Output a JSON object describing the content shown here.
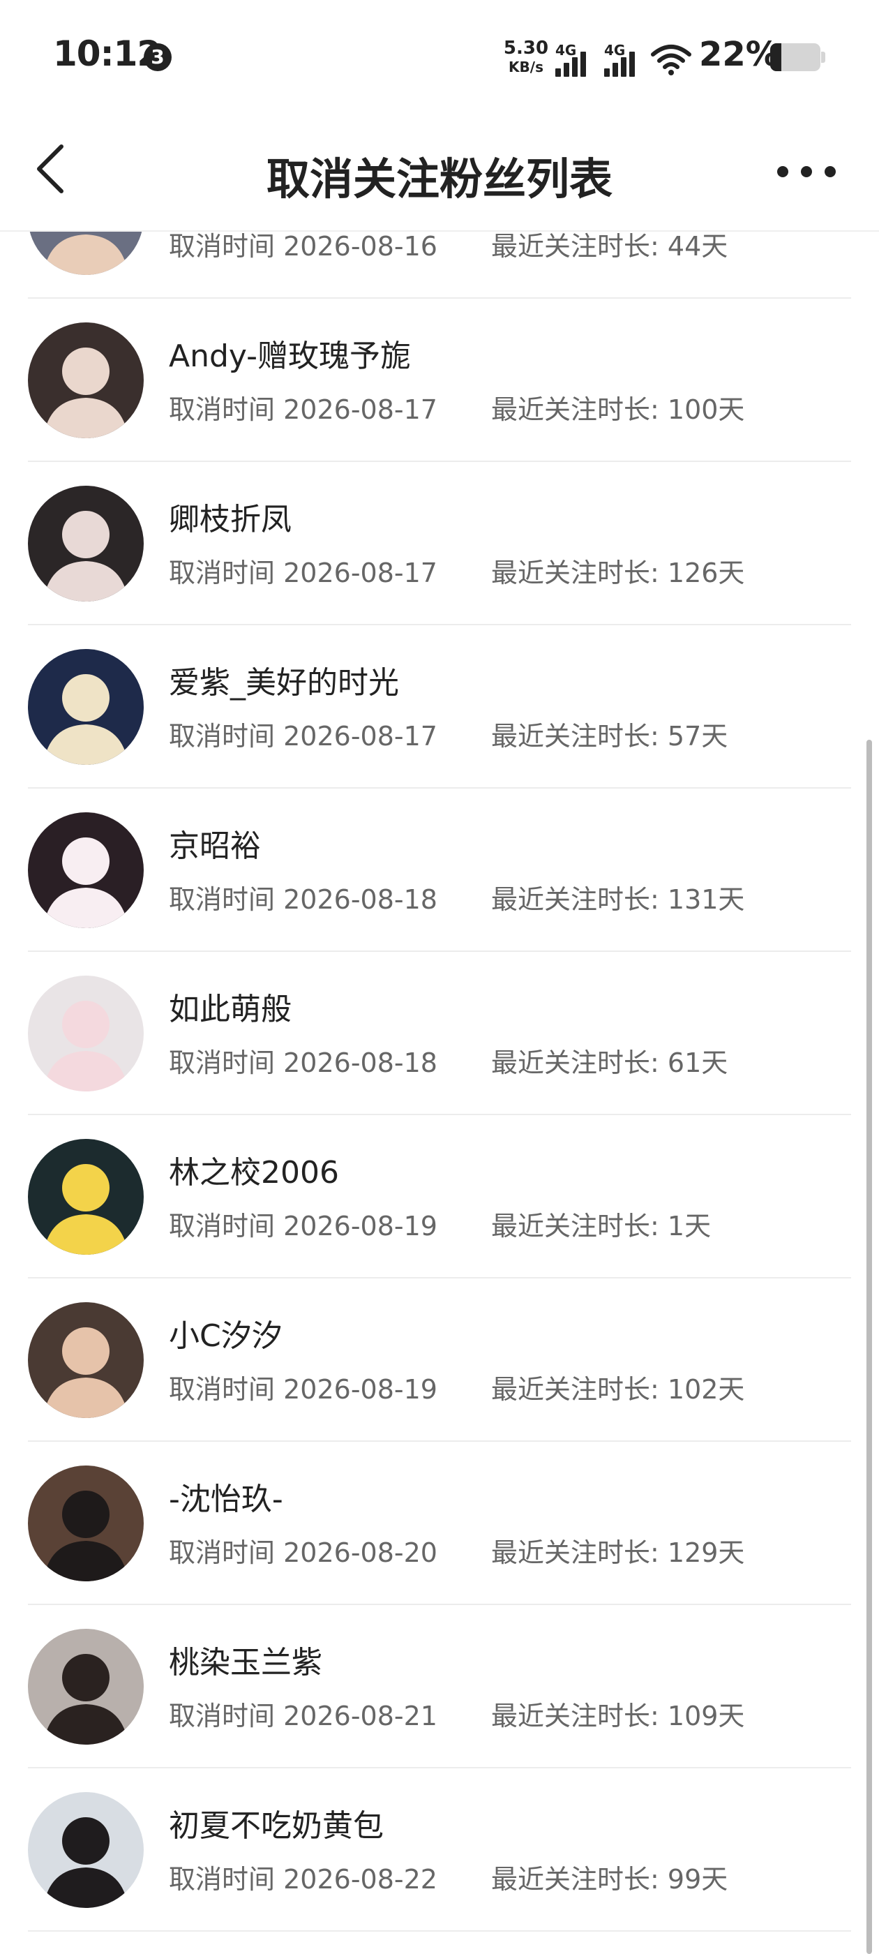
{
  "status_bar": {
    "time": "10:12",
    "notification_count": "3",
    "net_speed_value": "5.30",
    "net_speed_unit": "KB/s",
    "signal1_label": "4G",
    "signal2_label": "4G",
    "battery_percent": "22%",
    "battery_level": 0.22
  },
  "nav": {
    "title": "取消关注粉丝列表",
    "back_icon": "chevron-left-icon",
    "more_icon": "more-horizontal-icon"
  },
  "list": {
    "time_prefix": "取消时间",
    "duration_prefix": "最近关注时长:",
    "items": [
      {
        "name": "",
        "date": "2026-08-16",
        "duration": "44天",
        "avatar_bg": "#6a6f82",
        "avatar_fg": "#e9cdb8"
      },
      {
        "name": "Andy-赠玫瑰予旎",
        "date": "2026-08-17",
        "duration": "100天",
        "avatar_bg": "#3a2f2d",
        "avatar_fg": "#ead7cd"
      },
      {
        "name": "卿枝折凤",
        "date": "2026-08-17",
        "duration": "126天",
        "avatar_bg": "#2b2627",
        "avatar_fg": "#e8d9d6"
      },
      {
        "name": "爱紫_美好的时光",
        "date": "2026-08-17",
        "duration": "57天",
        "avatar_bg": "#1e2a4a",
        "avatar_fg": "#efe3c6"
      },
      {
        "name": "京昭裕",
        "date": "2026-08-18",
        "duration": "131天",
        "avatar_bg": "#2a1f25",
        "avatar_fg": "#f8eef2"
      },
      {
        "name": "如此萌般",
        "date": "2026-08-18",
        "duration": "61天",
        "avatar_bg": "#e9e4e6",
        "avatar_fg": "#f4d9de"
      },
      {
        "name": "林之校2006",
        "date": "2026-08-19",
        "duration": "1天",
        "avatar_bg": "#1c2b2e",
        "avatar_fg": "#f3d34a"
      },
      {
        "name": "小C汐汐",
        "date": "2026-08-19",
        "duration": "102天",
        "avatar_bg": "#4a3a33",
        "avatar_fg": "#e6c3aa"
      },
      {
        "name": "-沈怡玖-",
        "date": "2026-08-20",
        "duration": "129天",
        "avatar_bg": "#5a4236",
        "avatar_fg": "#1e1a1a"
      },
      {
        "name": "桃染玉兰紫",
        "date": "2026-08-21",
        "duration": "109天",
        "avatar_bg": "#b8b0ac",
        "avatar_fg": "#2a2220"
      },
      {
        "name": "初夏不吃奶黄包",
        "date": "2026-08-22",
        "duration": "99天",
        "avatar_bg": "#d8dde3",
        "avatar_fg": "#1f1c1e"
      }
    ]
  }
}
